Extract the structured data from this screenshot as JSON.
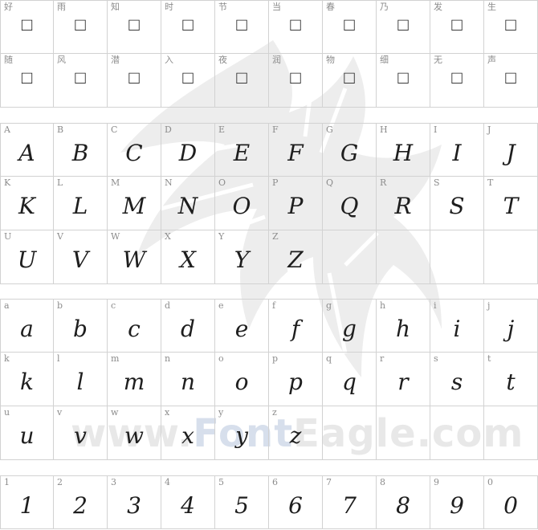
{
  "watermark": {
    "prefix": "www.",
    "accent": "Font",
    "suffix": "Eagle.com"
  },
  "sections": [
    {
      "id": "cjk",
      "cells": [
        {
          "label": "好",
          "glyph": "□"
        },
        {
          "label": "雨",
          "glyph": "□"
        },
        {
          "label": "知",
          "glyph": "□"
        },
        {
          "label": "时",
          "glyph": "□"
        },
        {
          "label": "节",
          "glyph": "□"
        },
        {
          "label": "当",
          "glyph": "□"
        },
        {
          "label": "春",
          "glyph": "□"
        },
        {
          "label": "乃",
          "glyph": "□"
        },
        {
          "label": "发",
          "glyph": "□"
        },
        {
          "label": "生",
          "glyph": "□"
        },
        {
          "label": "随",
          "glyph": "□"
        },
        {
          "label": "风",
          "glyph": "□"
        },
        {
          "label": "潜",
          "glyph": "□"
        },
        {
          "label": "入",
          "glyph": "□"
        },
        {
          "label": "夜",
          "glyph": "□"
        },
        {
          "label": "润",
          "glyph": "□"
        },
        {
          "label": "物",
          "glyph": "□"
        },
        {
          "label": "细",
          "glyph": "□"
        },
        {
          "label": "无",
          "glyph": "□"
        },
        {
          "label": "声",
          "glyph": "□"
        }
      ]
    },
    {
      "id": "uppercase",
      "cells": [
        {
          "label": "A",
          "glyph": "A"
        },
        {
          "label": "B",
          "glyph": "B"
        },
        {
          "label": "C",
          "glyph": "C"
        },
        {
          "label": "D",
          "glyph": "D"
        },
        {
          "label": "E",
          "glyph": "E"
        },
        {
          "label": "F",
          "glyph": "F"
        },
        {
          "label": "G",
          "glyph": "G"
        },
        {
          "label": "H",
          "glyph": "H"
        },
        {
          "label": "I",
          "glyph": "I"
        },
        {
          "label": "J",
          "glyph": "J"
        },
        {
          "label": "K",
          "glyph": "K"
        },
        {
          "label": "L",
          "glyph": "L"
        },
        {
          "label": "M",
          "glyph": "M"
        },
        {
          "label": "N",
          "glyph": "N"
        },
        {
          "label": "O",
          "glyph": "O"
        },
        {
          "label": "P",
          "glyph": "P"
        },
        {
          "label": "Q",
          "glyph": "Q"
        },
        {
          "label": "R",
          "glyph": "R"
        },
        {
          "label": "S",
          "glyph": "S"
        },
        {
          "label": "T",
          "glyph": "T"
        },
        {
          "label": "U",
          "glyph": "U"
        },
        {
          "label": "V",
          "glyph": "V"
        },
        {
          "label": "W",
          "glyph": "W"
        },
        {
          "label": "X",
          "glyph": "X"
        },
        {
          "label": "Y",
          "glyph": "Y"
        },
        {
          "label": "Z",
          "glyph": "Z"
        },
        {
          "label": "",
          "glyph": ""
        },
        {
          "label": "",
          "glyph": ""
        },
        {
          "label": "",
          "glyph": ""
        },
        {
          "label": "",
          "glyph": ""
        }
      ]
    },
    {
      "id": "lowercase",
      "cells": [
        {
          "label": "a",
          "glyph": "a"
        },
        {
          "label": "b",
          "glyph": "b"
        },
        {
          "label": "c",
          "glyph": "c"
        },
        {
          "label": "d",
          "glyph": "d"
        },
        {
          "label": "e",
          "glyph": "e"
        },
        {
          "label": "f",
          "glyph": "f"
        },
        {
          "label": "g",
          "glyph": "g"
        },
        {
          "label": "h",
          "glyph": "h"
        },
        {
          "label": "i",
          "glyph": "i"
        },
        {
          "label": "j",
          "glyph": "j"
        },
        {
          "label": "k",
          "glyph": "k"
        },
        {
          "label": "l",
          "glyph": "l"
        },
        {
          "label": "m",
          "glyph": "m"
        },
        {
          "label": "n",
          "glyph": "n"
        },
        {
          "label": "o",
          "glyph": "o"
        },
        {
          "label": "p",
          "glyph": "p"
        },
        {
          "label": "q",
          "glyph": "q"
        },
        {
          "label": "r",
          "glyph": "r"
        },
        {
          "label": "s",
          "glyph": "s"
        },
        {
          "label": "t",
          "glyph": "t"
        },
        {
          "label": "u",
          "glyph": "u"
        },
        {
          "label": "v",
          "glyph": "v"
        },
        {
          "label": "w",
          "glyph": "w"
        },
        {
          "label": "x",
          "glyph": "x"
        },
        {
          "label": "y",
          "glyph": "y"
        },
        {
          "label": "z",
          "glyph": "z"
        },
        {
          "label": "",
          "glyph": ""
        },
        {
          "label": "",
          "glyph": ""
        },
        {
          "label": "",
          "glyph": ""
        },
        {
          "label": "",
          "glyph": ""
        }
      ]
    },
    {
      "id": "digits",
      "cells": [
        {
          "label": "1",
          "glyph": "1"
        },
        {
          "label": "2",
          "glyph": "2"
        },
        {
          "label": "3",
          "glyph": "3"
        },
        {
          "label": "4",
          "glyph": "4"
        },
        {
          "label": "5",
          "glyph": "5"
        },
        {
          "label": "6",
          "glyph": "6"
        },
        {
          "label": "7",
          "glyph": "7"
        },
        {
          "label": "8",
          "glyph": "8"
        },
        {
          "label": "9",
          "glyph": "9"
        },
        {
          "label": "0",
          "glyph": "0"
        }
      ]
    }
  ]
}
